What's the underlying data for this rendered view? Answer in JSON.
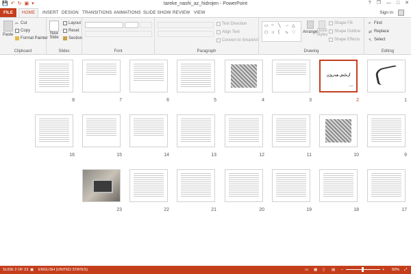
{
  "window": {
    "title": "tareke_nashi_az_hidrojen - PowerPoint",
    "help": "?",
    "restore": "❐",
    "minimize": "—",
    "maximize": "□",
    "close": "✕"
  },
  "qat": {
    "save": "💾",
    "undo": "↶",
    "redo": "↻",
    "start": "▣",
    "more": "▾"
  },
  "tabs": [
    "FILE",
    "HOME",
    "INSERT",
    "DESIGN",
    "TRANSITIONS",
    "ANIMATIONS",
    "SLIDE SHOW",
    "REVIEW",
    "VIEW"
  ],
  "account": {
    "signin": "Sign in"
  },
  "ribbon": {
    "clipboard": {
      "label": "Clipboard",
      "paste": "Paste",
      "cut": "Cut",
      "copy": "Copy",
      "format_painter": "Format Painter"
    },
    "slides": {
      "label": "Slides",
      "new_slide_1": "New",
      "new_slide_2": "Slide",
      "layout": "Layout",
      "reset": "Reset",
      "section": "Section"
    },
    "font": {
      "label": "Font"
    },
    "paragraph": {
      "label": "Paragraph",
      "text_direction": "Text Direction",
      "align_text": "Align Text",
      "convert_smartart": "Convert to SmartArt"
    },
    "drawing": {
      "label": "Drawing",
      "arrange": "Arrange",
      "quick_styles_1": "Quick",
      "quick_styles_2": "Styles",
      "shape_fill": "Shape Fill",
      "shape_outline": "Shape Outline",
      "shape_effects": "Shape Effects"
    },
    "editing": {
      "label": "Editing",
      "find": "Find",
      "replace": "Replace",
      "select": "Select"
    }
  },
  "slides": [
    {
      "n": "1",
      "kind": "calligraphy"
    },
    {
      "n": "2",
      "kind": "cover",
      "title": "آزمایش هیدروژن",
      "sub": "محمد"
    },
    {
      "n": "3",
      "kind": "text-sparse"
    },
    {
      "n": "4",
      "kind": "picture"
    },
    {
      "n": "5",
      "kind": "text"
    },
    {
      "n": "6",
      "kind": "text-half"
    },
    {
      "n": "7",
      "kind": "text-sparse"
    },
    {
      "n": "8",
      "kind": "text"
    },
    {
      "n": "9",
      "kind": "text"
    },
    {
      "n": "10",
      "kind": "picture"
    },
    {
      "n": "11",
      "kind": "text"
    },
    {
      "n": "12",
      "kind": "text"
    },
    {
      "n": "13",
      "kind": "text"
    },
    {
      "n": "14",
      "kind": "text-half"
    },
    {
      "n": "15",
      "kind": "text-half"
    },
    {
      "n": "16",
      "kind": "text"
    },
    {
      "n": "17",
      "kind": "text"
    },
    {
      "n": "18",
      "kind": "text"
    },
    {
      "n": "19",
      "kind": "text"
    },
    {
      "n": "20",
      "kind": "text"
    },
    {
      "n": "21",
      "kind": "text"
    },
    {
      "n": "22",
      "kind": "text"
    },
    {
      "n": "23",
      "kind": "photo"
    }
  ],
  "selected_slide": "2",
  "status": {
    "slide_count": "SLIDE 2 OF 23",
    "language": "ENGLISH (UNITED STATES)",
    "zoom": "50%",
    "zoom_minus": "−",
    "zoom_plus": "+"
  },
  "colors": {
    "accent": "#c43e1c",
    "ribbon_bg": "#f3f3f3"
  }
}
